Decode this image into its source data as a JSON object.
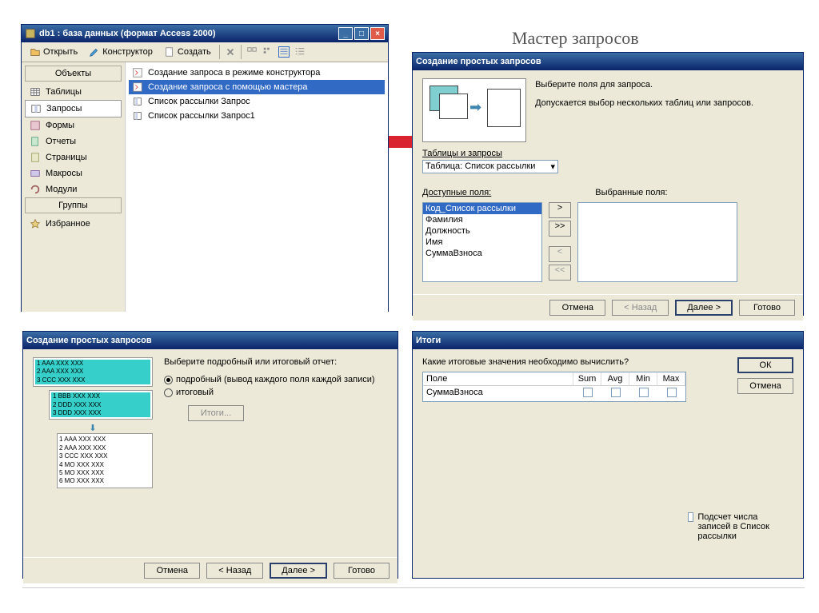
{
  "page_title": "Мастер запросов",
  "db_window": {
    "title": "db1 : база данных (формат Access 2000)",
    "toolbar": {
      "open": "Открыть",
      "design": "Конструктор",
      "create": "Создать"
    },
    "sidebar": {
      "header_objects": "Объекты",
      "items": [
        {
          "label": "Таблицы"
        },
        {
          "label": "Запросы"
        },
        {
          "label": "Формы"
        },
        {
          "label": "Отчеты"
        },
        {
          "label": "Страницы"
        },
        {
          "label": "Макросы"
        },
        {
          "label": "Модули"
        }
      ],
      "header_groups": "Группы",
      "favorites": "Избранное"
    },
    "list": [
      "Создание запроса в режиме конструктора",
      "Создание запроса с помощью мастера",
      "Список рассылки Запрос",
      "Список рассылки Запрос1"
    ]
  },
  "wizard1": {
    "title": "Создание простых запросов",
    "intro1": "Выберите поля для запроса.",
    "intro2": "Допускается выбор нескольких таблиц или запросов.",
    "tables_label": "Таблицы и запросы",
    "combo_value": "Таблица: Список рассылки",
    "available_label": "Доступные поля:",
    "selected_label": "Выбранные поля:",
    "available": [
      "Код_Список рассылки",
      "Фамилия",
      "Должность",
      "Имя",
      "СуммаВзноса"
    ],
    "buttons": {
      "cancel": "Отмена",
      "back": "< Назад",
      "next": "Далее >",
      "finish": "Готово"
    }
  },
  "wizard2": {
    "title": "Создание простых запросов",
    "prompt": "Выберите подробный или итоговый отчет:",
    "opt_detail": "подробный (вывод каждого поля каждой записи)",
    "opt_summary": "итоговый",
    "summary_btn": "Итоги...",
    "buttons": {
      "cancel": "Отмена",
      "back": "< Назад",
      "next": "Далее >",
      "finish": "Готово"
    }
  },
  "wizard3": {
    "title": "Итоги",
    "prompt": "Какие итоговые значения необходимо вычислить?",
    "col_field": "Поле",
    "col_sum": "Sum",
    "col_avg": "Avg",
    "col_min": "Min",
    "col_max": "Max",
    "row_field": "СуммаВзноса",
    "count_label": "Подсчет числа записей в Список рассылки",
    "ok": "ОК",
    "cancel": "Отмена"
  }
}
